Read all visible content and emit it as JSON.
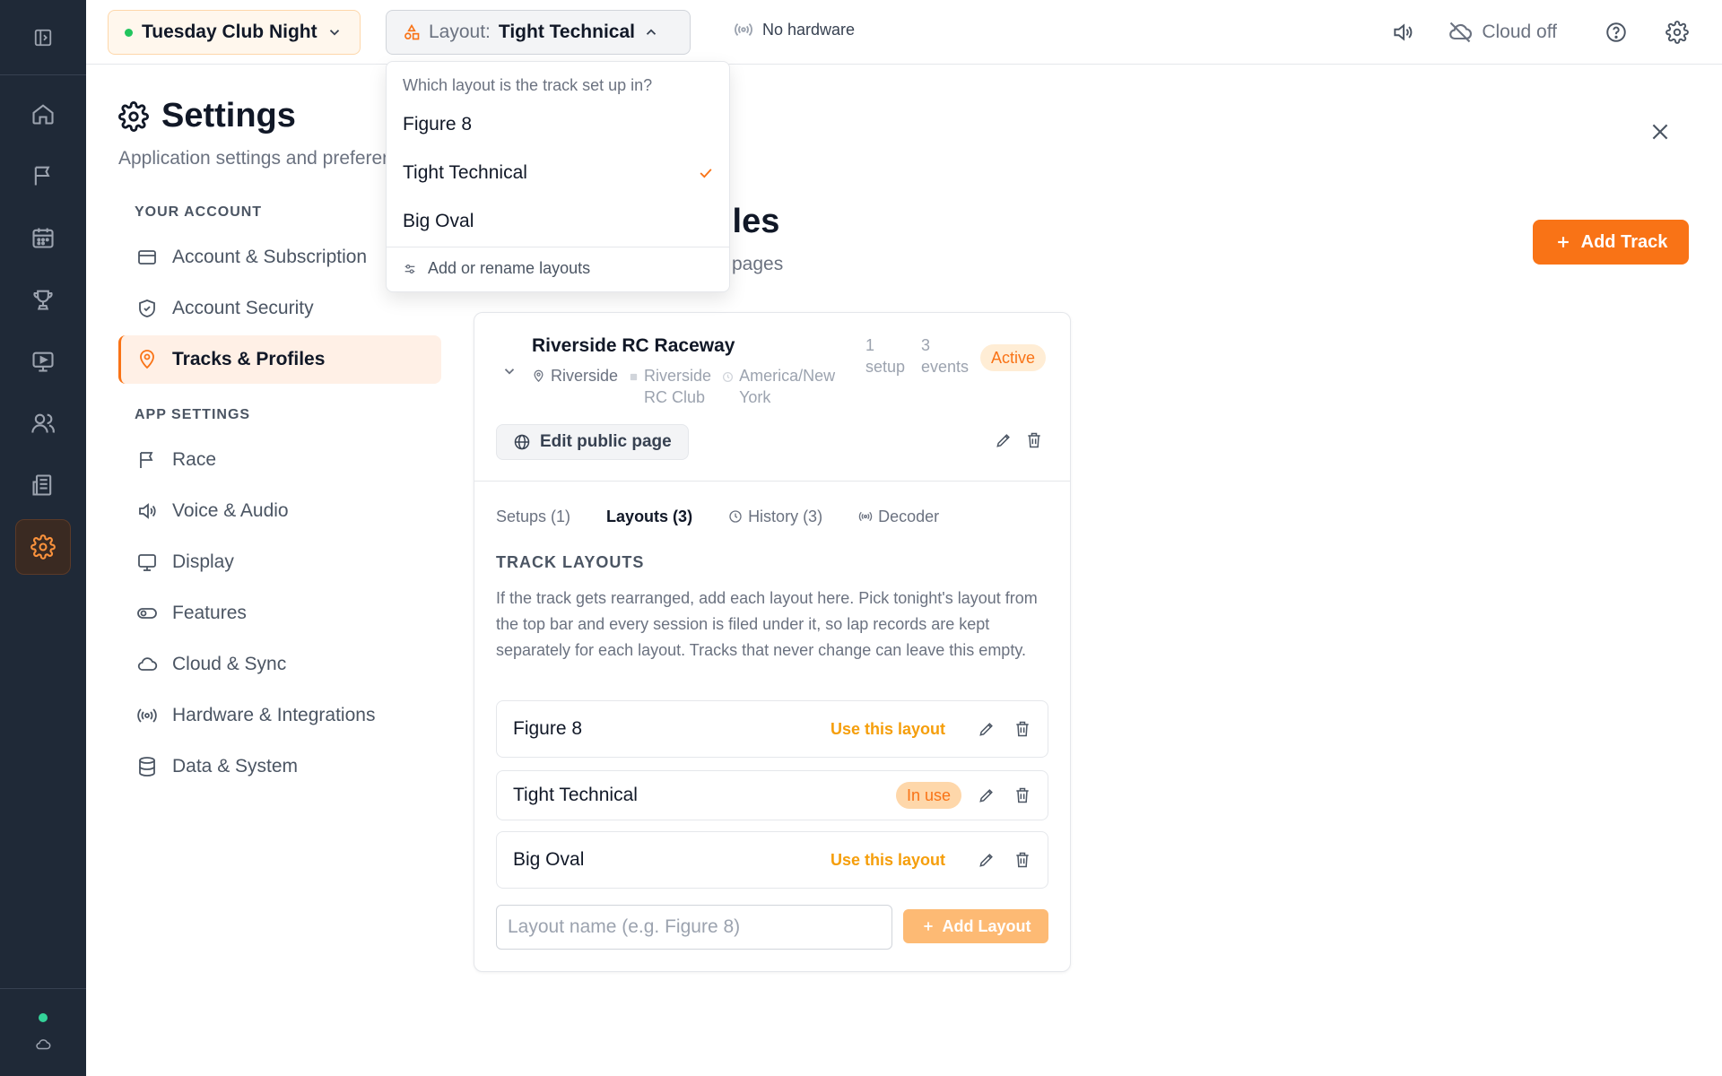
{
  "topbar": {
    "session_name": "Tuesday Club Night",
    "layout_prefix": "Layout:",
    "layout_value": "Tight Technical",
    "hardware": "No hardware",
    "cloud": "Cloud off"
  },
  "dropdown": {
    "question": "Which layout is the track set up in?",
    "options": [
      "Figure 8",
      "Tight Technical",
      "Big Oval"
    ],
    "selected": "Tight Technical",
    "footer": "Add or rename layouts"
  },
  "settings": {
    "title": "Settings",
    "subtitle": "Application settings and preferences"
  },
  "nav": {
    "account_section": "YOUR ACCOUNT",
    "account_items": [
      {
        "label": "Account & Subscription",
        "icon": "credit-card-icon"
      },
      {
        "label": "Account Security",
        "icon": "shield-icon"
      },
      {
        "label": "Tracks & Profiles",
        "icon": "map-pin-icon"
      }
    ],
    "app_section": "APP SETTINGS",
    "app_items": [
      {
        "label": "Race",
        "icon": "flag-icon"
      },
      {
        "label": "Voice & Audio",
        "icon": "speaker-icon"
      },
      {
        "label": "Display",
        "icon": "monitor-icon"
      },
      {
        "label": "Features",
        "icon": "toggle-icon"
      },
      {
        "label": "Cloud & Sync",
        "icon": "cloud-icon"
      },
      {
        "label": "Hardware & Integrations",
        "icon": "broadcast-icon"
      },
      {
        "label": "Data & System",
        "icon": "database-icon"
      }
    ]
  },
  "main": {
    "heading_visible": "iles",
    "subheading_visible": "pages",
    "add_track": "Add Track"
  },
  "track": {
    "name": "Riverside RC Raceway",
    "location": "Riverside",
    "club_line1": "Riverside",
    "club_line2": "RC Club",
    "tz_line1": "America/New",
    "tz_line2": "York",
    "setups_num": "1",
    "setups_word": "setup",
    "events_num": "3",
    "events_word": "events",
    "status": "Active",
    "edit_public": "Edit public page",
    "tabs": [
      {
        "label": "Setups (1)"
      },
      {
        "label": "Layouts (3)"
      },
      {
        "label": "History (3)"
      },
      {
        "label": "Decoder"
      }
    ],
    "layouts_title": "TRACK LAYOUTS",
    "layouts_desc": "If the track gets rearranged, add each layout here. Pick tonight's layout from the top bar and every session is filed under it, so lap records are kept separately for each layout. Tracks that never change can leave this empty.",
    "layouts": [
      {
        "name": "Figure 8",
        "action": "Use this layout"
      },
      {
        "name": "Tight Technical",
        "action": "In use"
      },
      {
        "name": "Big Oval",
        "action": "Use this layout"
      }
    ],
    "input_placeholder": "Layout name (e.g. Figure 8)",
    "add_layout": "Add Layout"
  },
  "colors": {
    "accent": "#f97316",
    "rail": "#1f2937",
    "active_bg": "#fff0e6"
  }
}
